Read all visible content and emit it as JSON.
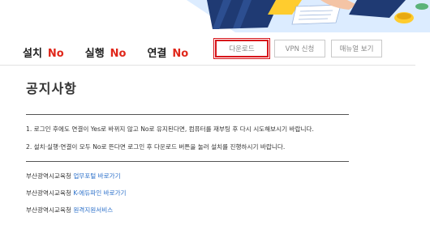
{
  "status": {
    "items": [
      {
        "label": "설치",
        "value": "No"
      },
      {
        "label": "실행",
        "value": "No"
      },
      {
        "label": "연결",
        "value": "No"
      }
    ],
    "value_color": "#e0271a"
  },
  "buttons": {
    "download": "다운로드",
    "vpn": "VPN 신청",
    "manual": "매뉴얼 보기",
    "highlight_color": "#d7151b"
  },
  "notice": {
    "title": "공지사항",
    "lines": [
      "1. 로그인 후에도 연결이 Yes로 바뀌지 않고 No로 유지된다면, 컴퓨터를 재부팅 후 다시 시도해보시기 바랍니다.",
      "2. 설치·실행·연결이 모두 No로 뜬다면 로그인 후 다운로드 버튼을 눌러 설치를 진행하시기 바랍니다."
    ]
  },
  "links": [
    {
      "prefix": "부산광역시교육청",
      "link": "업무포털 바로가기"
    },
    {
      "prefix": "부산광역시교육청",
      "link": "K-에듀파인 바로가기"
    },
    {
      "prefix": "부산광역시교육청",
      "link": "원격지원서비스"
    }
  ],
  "banner": {
    "illustration": "office-desk-illustration"
  }
}
